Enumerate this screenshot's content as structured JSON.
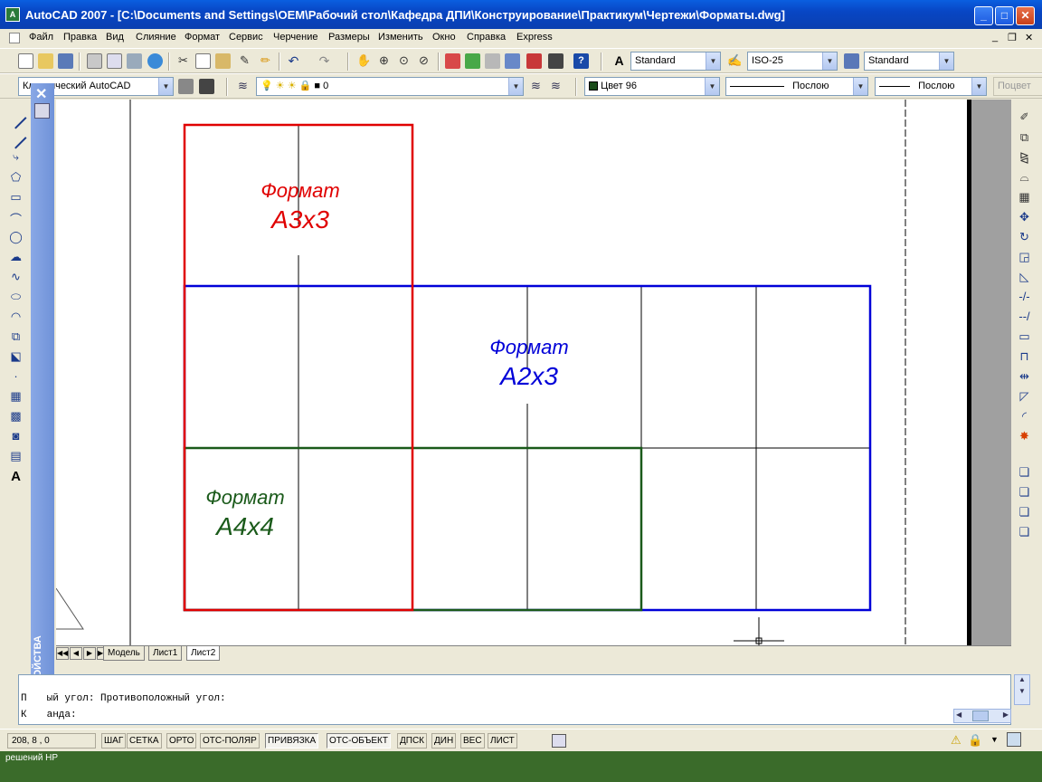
{
  "window": {
    "title": "AutoCAD 2007 - [C:\\Documents and Settings\\OEM\\Рабочий стол\\Кафедра ДПИ\\Конструирование\\Практикум\\Чертежи\\Форматы.dwg]",
    "app_icon": "A",
    "buttons": {
      "minimize": "_",
      "maximize": "□",
      "close": "✕"
    }
  },
  "menu": {
    "items": [
      "Файл",
      "Правка",
      "Вид",
      "Слияние",
      "Формат",
      "Сервис",
      "Черчение",
      "Размеры",
      "Изменить",
      "Окно",
      "Справка",
      "Express"
    ],
    "doc_controls": {
      "minimize": "_",
      "restore": "❐",
      "close": "✕"
    }
  },
  "toolbar1": {
    "text_style": "Standard",
    "dim_style": "ISO-25",
    "table_style": "Standard"
  },
  "toolbar2": {
    "workspace": "Классический AutoCAD",
    "layer": "0",
    "color": "Цвет 96",
    "color_swatch": "#1b4d1b",
    "linetype": "Послою",
    "lineweight": "Послою",
    "plot_style": "Поцвет"
  },
  "drawing": {
    "a3": {
      "label1": "Формат",
      "label2": "А3х3",
      "color": "#e00000"
    },
    "a2": {
      "label1": "Формат",
      "label2": "А2х3",
      "color": "#0000d8"
    },
    "a4": {
      "label1": "Формат",
      "label2": "А4х4",
      "color": "#1a5a1a"
    }
  },
  "properties_palette": {
    "title": "СВОЙСТВА",
    "close": "✕"
  },
  "tabs": {
    "nav": [
      "◀◀",
      "◀",
      "▶",
      "▶▶"
    ],
    "items": [
      "Модель",
      "Лист1",
      "Лист2"
    ],
    "active": "Лист2"
  },
  "command": {
    "line1": "Первый угол: Противоположный угол:",
    "line1_visible": "ый угол: Противоположный угол:",
    "line1_prefix": "П",
    "line2_prefix": "К",
    "line2_visible": "анда:"
  },
  "status": {
    "coords": "208, 8 , 0",
    "buttons": [
      {
        "label": "ШАГ",
        "on": false
      },
      {
        "label": "СЕТКА",
        "on": false
      },
      {
        "label": "ОРТО",
        "on": false
      },
      {
        "label": "ОТС-ПОЛЯР",
        "on": false
      },
      {
        "label": "ПРИВЯЗКА",
        "on": true
      },
      {
        "label": "ОТС-ОБЪЕКТ",
        "on": true
      },
      {
        "label": "ДПСК",
        "on": false
      },
      {
        "label": "ДИН",
        "on": false
      },
      {
        "label": "ВЕС",
        "on": false
      },
      {
        "label": "ЛИСТ",
        "on": false
      }
    ]
  },
  "taskbar": {
    "text": "решений HP"
  }
}
